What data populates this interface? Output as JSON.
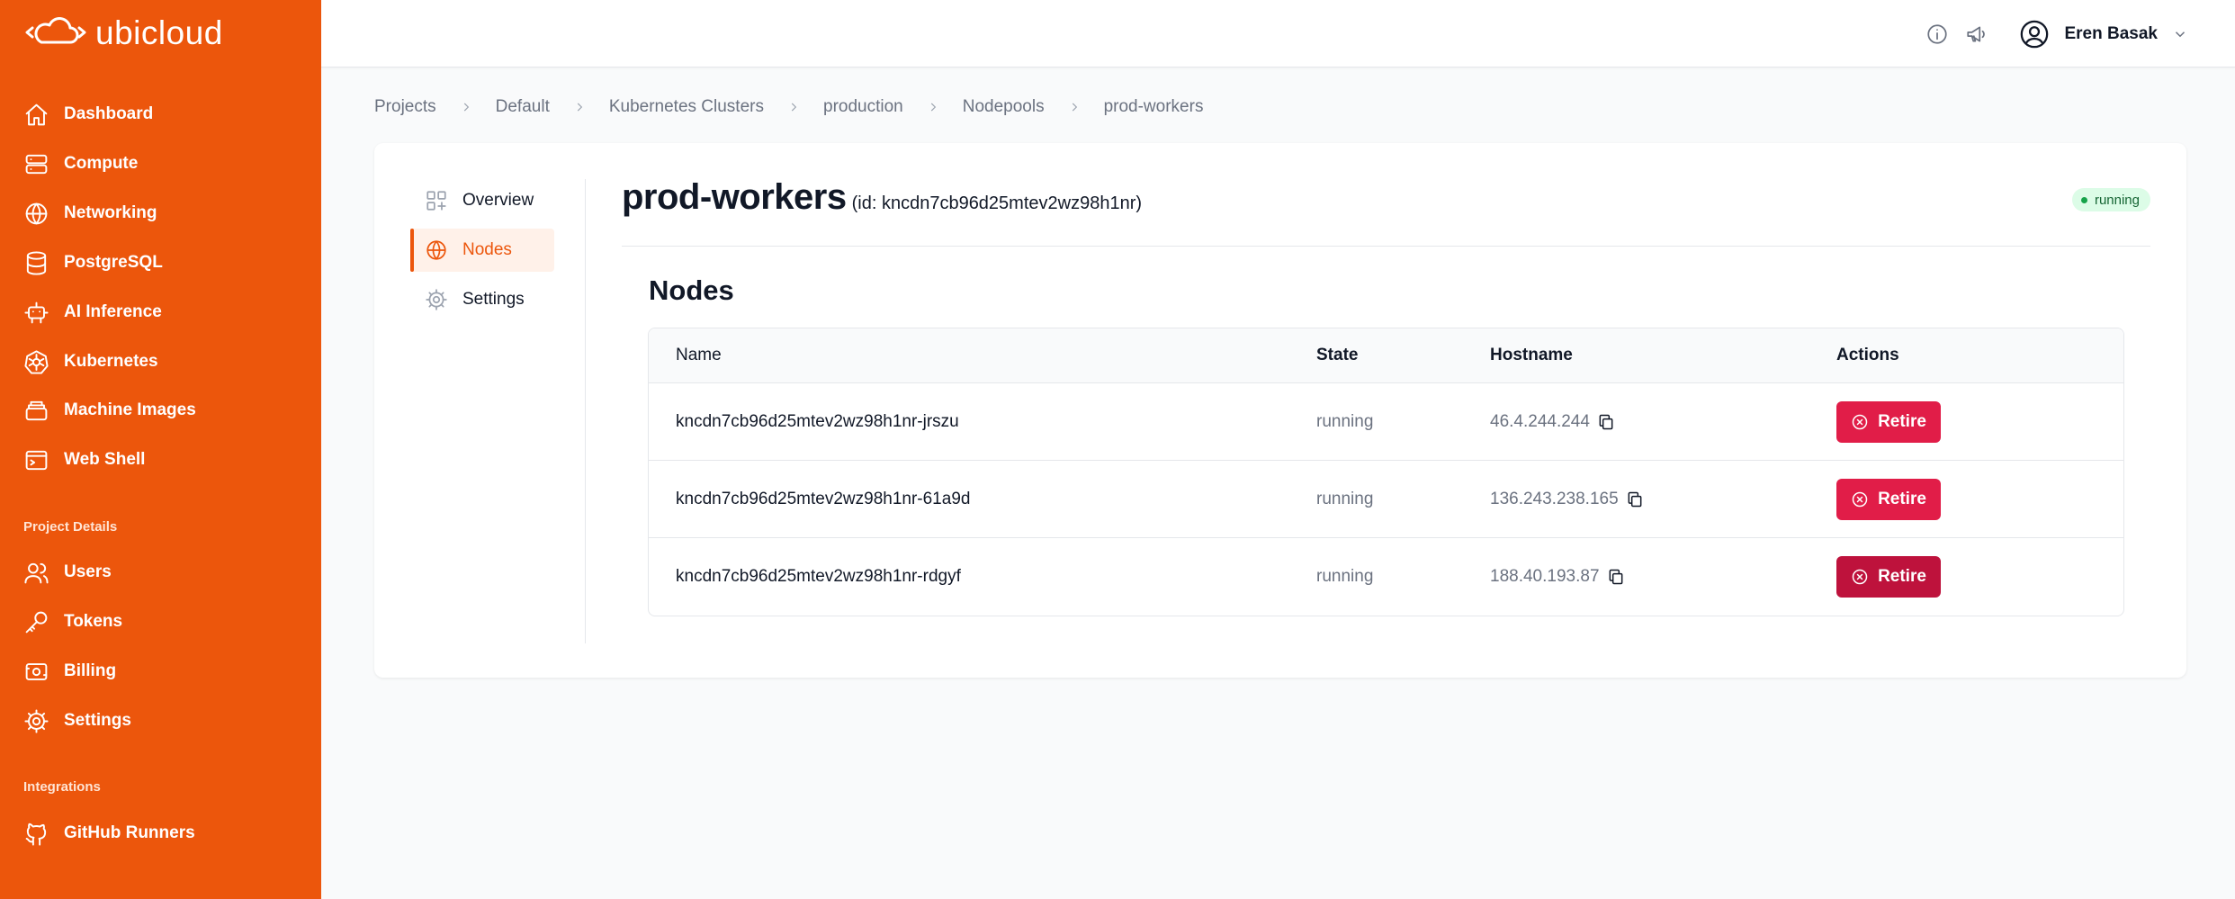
{
  "app": {
    "logo_text": "ubicloud"
  },
  "sidebar": {
    "items": [
      {
        "label": "Dashboard",
        "icon": "home-icon"
      },
      {
        "label": "Compute",
        "icon": "server-icon"
      },
      {
        "label": "Networking",
        "icon": "globe-icon"
      },
      {
        "label": "PostgreSQL",
        "icon": "database-icon"
      },
      {
        "label": "AI Inference",
        "icon": "robot-icon"
      },
      {
        "label": "Kubernetes",
        "icon": "kubernetes-icon"
      },
      {
        "label": "Machine Images",
        "icon": "image-stack-icon"
      },
      {
        "label": "Web Shell",
        "icon": "terminal-icon"
      }
    ],
    "project_section": "Project Details",
    "project_items": [
      {
        "label": "Users",
        "icon": "users-icon"
      },
      {
        "label": "Tokens",
        "icon": "key-icon"
      },
      {
        "label": "Billing",
        "icon": "billing-icon"
      },
      {
        "label": "Settings",
        "icon": "gear-icon"
      }
    ],
    "integrations_section": "Integrations",
    "integration_items": [
      {
        "label": "GitHub Runners",
        "icon": "github-icon"
      }
    ]
  },
  "topbar": {
    "user_name": "Eren Basak"
  },
  "breadcrumb": [
    "Projects",
    "Default",
    "Kubernetes Clusters",
    "production",
    "Nodepools",
    "prod-workers"
  ],
  "subnav": {
    "overview": "Overview",
    "nodes": "Nodes",
    "settings": "Settings"
  },
  "page": {
    "title": "prod-workers",
    "id_text": "(id: kncdn7cb96d25mtev2wz98h1nr)",
    "status": "running",
    "section_title": "Nodes"
  },
  "table": {
    "headers": {
      "name": "Name",
      "state": "State",
      "hostname": "Hostname",
      "actions": "Actions"
    },
    "rows": [
      {
        "name": "kncdn7cb96d25mtev2wz98h1nr-jrszu",
        "state": "running",
        "hostname": "46.4.244.244",
        "action": "Retire"
      },
      {
        "name": "kncdn7cb96d25mtev2wz98h1nr-61a9d",
        "state": "running",
        "hostname": "136.243.238.165",
        "action": "Retire"
      },
      {
        "name": "kncdn7cb96d25mtev2wz98h1nr-rdgyf",
        "state": "running",
        "hostname": "188.40.193.87",
        "action": "Retire"
      }
    ]
  },
  "colors": {
    "brand": "#ec560c",
    "danger": "#e11d48",
    "danger_hover": "#be123c",
    "success": "#16a34a"
  }
}
